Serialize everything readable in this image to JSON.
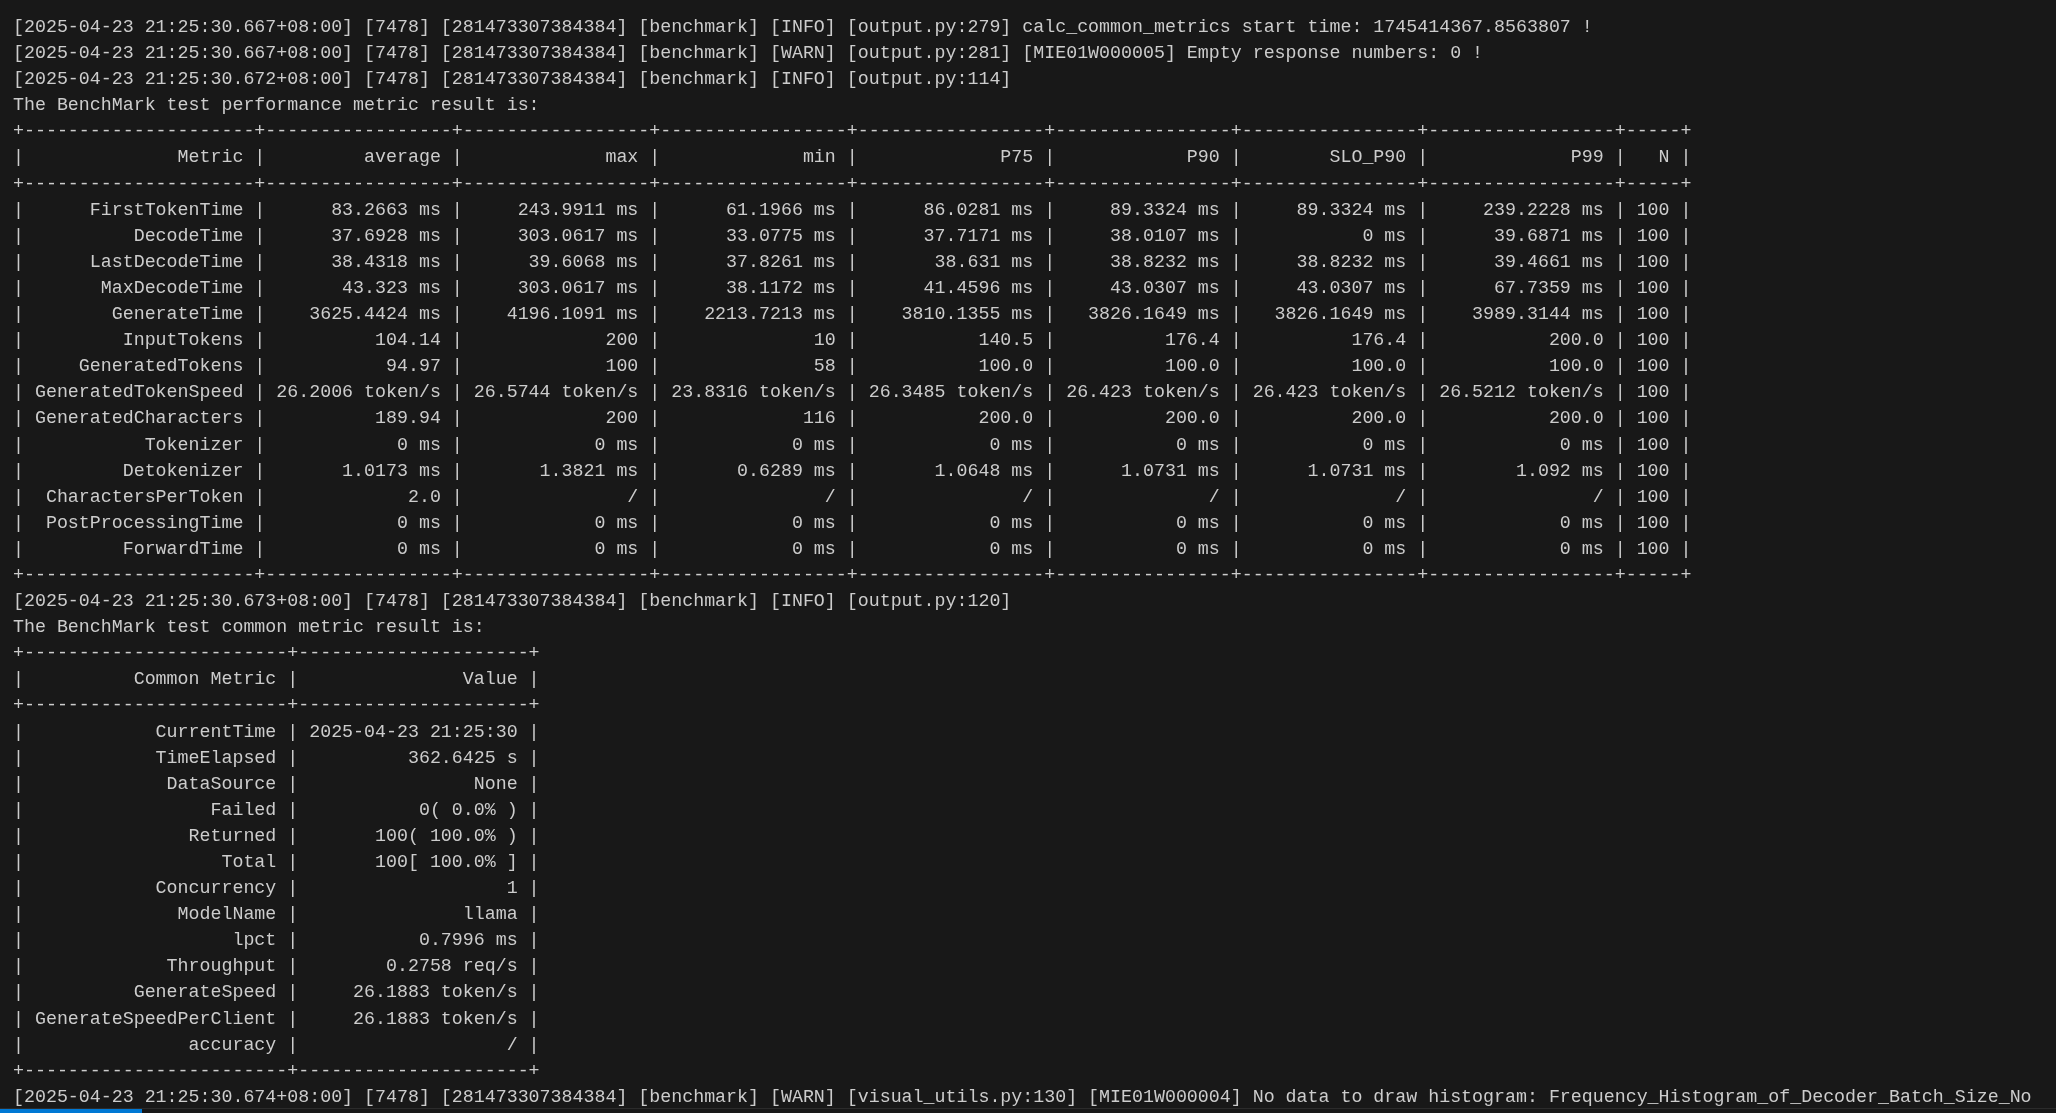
{
  "terminal": {
    "lines": [
      "[2025-04-23 21:25:30.667+08:00] [7478] [281473307384384] [benchmark] [INFO] [output.py:279] calc_common_metrics start time: 1745414367.8563807 !",
      "[2025-04-23 21:25:30.667+08:00] [7478] [281473307384384] [benchmark] [WARN] [output.py:281] [MIE01W000005] Empty response numbers: 0 !",
      "[2025-04-23 21:25:30.672+08:00] [7478] [281473307384384] [benchmark] [INFO] [output.py:114]",
      "The BenchMark test performance metric result is:",
      "+---------------------+-----------------+-----------------+-----------------+-----------------+----------------+----------------+-----------------+-----+",
      "|              Metric |         average |             max |             min |             P75 |            P90 |        SLO_P90 |             P99 |   N |",
      "+---------------------+-----------------+-----------------+-----------------+-----------------+----------------+----------------+-----------------+-----+",
      "|      FirstTokenTime |      83.2663 ms |     243.9911 ms |      61.1966 ms |      86.0281 ms |     89.3324 ms |     89.3324 ms |     239.2228 ms | 100 |",
      "|          DecodeTime |      37.6928 ms |     303.0617 ms |      33.0775 ms |      37.7171 ms |     38.0107 ms |           0 ms |      39.6871 ms | 100 |",
      "|      LastDecodeTime |      38.4318 ms |      39.6068 ms |      37.8261 ms |       38.631 ms |     38.8232 ms |     38.8232 ms |      39.4661 ms | 100 |",
      "|       MaxDecodeTime |       43.323 ms |     303.0617 ms |      38.1172 ms |      41.4596 ms |     43.0307 ms |     43.0307 ms |      67.7359 ms | 100 |",
      "|        GenerateTime |    3625.4424 ms |    4196.1091 ms |    2213.7213 ms |    3810.1355 ms |   3826.1649 ms |   3826.1649 ms |    3989.3144 ms | 100 |",
      "|         InputTokens |          104.14 |             200 |              10 |           140.5 |          176.4 |          176.4 |           200.0 | 100 |",
      "|     GeneratedTokens |           94.97 |             100 |              58 |           100.0 |          100.0 |          100.0 |           100.0 | 100 |",
      "| GeneratedTokenSpeed | 26.2006 token/s | 26.5744 token/s | 23.8316 token/s | 26.3485 token/s | 26.423 token/s | 26.423 token/s | 26.5212 token/s | 100 |",
      "| GeneratedCharacters |          189.94 |             200 |             116 |           200.0 |          200.0 |          200.0 |           200.0 | 100 |",
      "|           Tokenizer |            0 ms |            0 ms |            0 ms |            0 ms |           0 ms |           0 ms |            0 ms | 100 |",
      "|         Detokenizer |       1.0173 ms |       1.3821 ms |       0.6289 ms |       1.0648 ms |      1.0731 ms |      1.0731 ms |        1.092 ms | 100 |",
      "|  CharactersPerToken |             2.0 |               / |               / |               / |              / |              / |               / | 100 |",
      "|  PostProcessingTime |            0 ms |            0 ms |            0 ms |            0 ms |           0 ms |           0 ms |            0 ms | 100 |",
      "|         ForwardTime |            0 ms |            0 ms |            0 ms |            0 ms |           0 ms |           0 ms |            0 ms | 100 |",
      "+---------------------+-----------------+-----------------+-----------------+-----------------+----------------+----------------+-----------------+-----+",
      "[2025-04-23 21:25:30.673+08:00] [7478] [281473307384384] [benchmark] [INFO] [output.py:120]",
      "The BenchMark test common metric result is:",
      "+------------------------+---------------------+",
      "|          Common Metric |               Value |",
      "+------------------------+---------------------+",
      "|            CurrentTime | 2025-04-23 21:25:30 |",
      "|            TimeElapsed |          362.6425 s |",
      "|             DataSource |                None |",
      "|                 Failed |           0( 0.0% ) |",
      "|               Returned |       100( 100.0% ) |",
      "|                  Total |       100[ 100.0% ] |",
      "|            Concurrency |                   1 |",
      "|              ModelName |               llama |",
      "|                   lpct |           0.7996 ms |",
      "|             Throughput |        0.2758 req/s |",
      "|          GenerateSpeed |     26.1883 token/s |",
      "| GenerateSpeedPerClient |     26.1883 token/s |",
      "|               accuracy |                   / |",
      "+------------------------+---------------------+",
      "[2025-04-23 21:25:30.674+08:00] [7478] [281473307384384] [benchmark] [WARN] [visual_utils.py:130] [MIE01W000004] No data to draw histogram: Frequency_Histogram_of_Decoder_Batch_Size_No"
    ]
  }
}
